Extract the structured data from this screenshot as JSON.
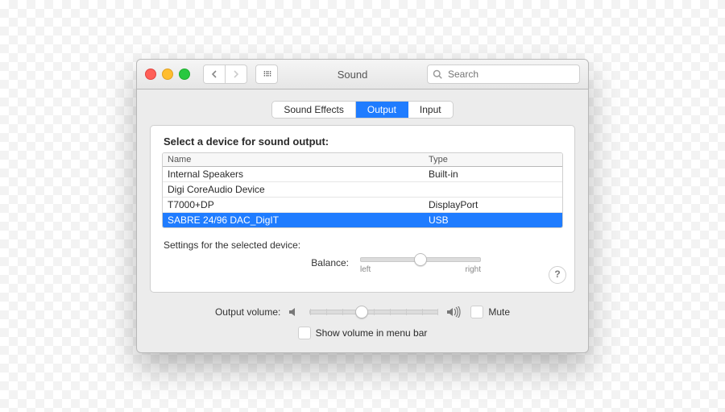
{
  "window": {
    "title": "Sound"
  },
  "search": {
    "placeholder": "Search"
  },
  "tabs": [
    {
      "label": "Sound Effects",
      "active": false
    },
    {
      "label": "Output",
      "active": true
    },
    {
      "label": "Input",
      "active": false
    }
  ],
  "heading": "Select a device for sound output:",
  "table": {
    "columns": {
      "name": "Name",
      "type": "Type"
    },
    "rows": [
      {
        "name": "Internal Speakers",
        "type": "Built-in",
        "selected": false
      },
      {
        "name": "Digi CoreAudio Device",
        "type": "",
        "selected": false
      },
      {
        "name": "T7000+DP",
        "type": "DisplayPort",
        "selected": false
      },
      {
        "name": "SABRE 24/96 DAC_DigIT",
        "type": "USB",
        "selected": true
      }
    ]
  },
  "settings_label": "Settings for the selected device:",
  "balance": {
    "label": "Balance:",
    "left_label": "left",
    "right_label": "right",
    "value_percent": 50
  },
  "help_button": "?",
  "volume": {
    "label": "Output volume:",
    "value_percent": 40,
    "mute_label": "Mute",
    "mute_checked": false
  },
  "menubar": {
    "label": "Show volume in menu bar",
    "checked": false
  }
}
